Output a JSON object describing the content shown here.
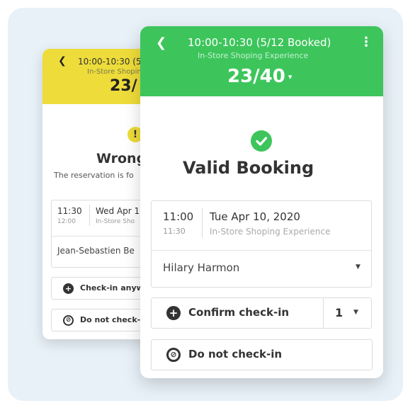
{
  "back_card": {
    "header": {
      "back_icon": "chevron-left-icon",
      "time": "10:00-10:30 (5/",
      "subtitle": "In-Store Shopin",
      "count": "23/"
    },
    "status": {
      "icon": "warning-icon",
      "icon_glyph": "!",
      "title": "Wrong",
      "message": "The reservation is fo"
    },
    "booking": {
      "time_start": "11:30",
      "time_end": "12:00",
      "date": "Wed Apr 1",
      "experience": "In-Store Sho",
      "guest": "Jean-Sebastien Be"
    },
    "checkin_anyway": "Check-in anyw",
    "do_not_checkin": "Do not check-i"
  },
  "front_card": {
    "header": {
      "back_icon": "chevron-left-icon",
      "time": "10:00-10:30 (5/12 Booked)",
      "subtitle": "In-Store Shoping Experience",
      "count": "23/40",
      "menu_icon": "more-vertical-icon"
    },
    "status": {
      "icon": "check-circle-icon",
      "title": "Valid Booking"
    },
    "booking": {
      "time_start": "11:00",
      "time_end": "11:30",
      "date": "Tue Apr 10, 2020",
      "experience": "In-Store Shoping Experience",
      "guest": "Hilary Harmon"
    },
    "confirm_label": "Confirm check-in",
    "quantity": "1",
    "do_not_checkin": "Do not check-in"
  },
  "colors": {
    "valid_green": "#3dc55c",
    "warning_yellow": "#eedc3a",
    "panel_bg": "#e8f1f8"
  }
}
